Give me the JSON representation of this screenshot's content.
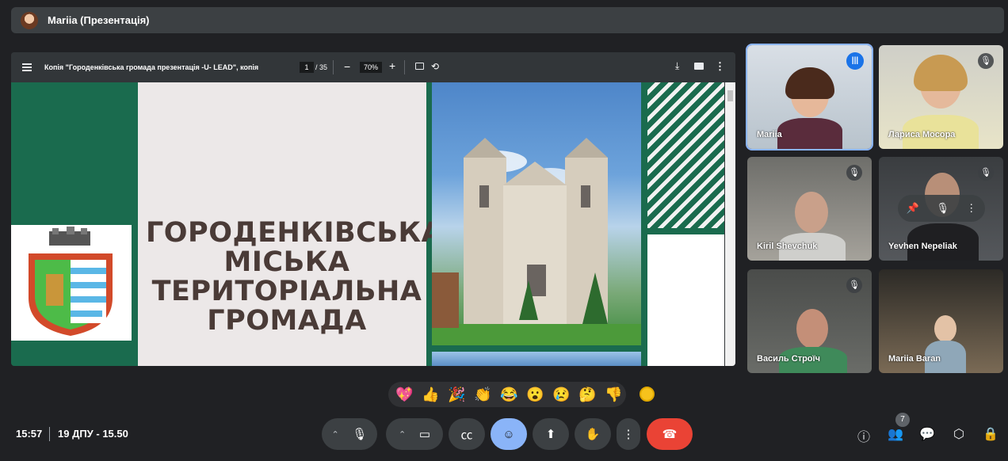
{
  "presenter": {
    "name": "Mariia (Презентація)"
  },
  "viewer": {
    "doc_title": "Копія \"Городенківська громада презентація -U- LEAD\", копія",
    "page_current": "1",
    "page_total": "/ 35",
    "zoom": "70%",
    "slide_title": "ГОРОДЕНКІВСЬКА МІСЬКА ТЕРИТОРІАЛЬНА ГРОМАДА"
  },
  "participants": [
    {
      "name": "Mariia"
    },
    {
      "name": "Лариса Мосора"
    },
    {
      "name": "Kiril Shevchuk"
    },
    {
      "name": "Yevhen Nepeliak"
    },
    {
      "name": "Василь Строїч"
    },
    {
      "name": "Mariia Baran"
    }
  ],
  "reactions": [
    "💖",
    "👍",
    "🎉",
    "👏",
    "😂",
    "😮",
    "😢",
    "🤔",
    "👎"
  ],
  "footer": {
    "time": "15:57",
    "meeting_name": "19 ДПУ - 15.50",
    "people_count": "7"
  },
  "colors": {
    "leave": "#ea4335",
    "active_control": "#8ab4f8",
    "slide_green": "#1a6b4e"
  }
}
